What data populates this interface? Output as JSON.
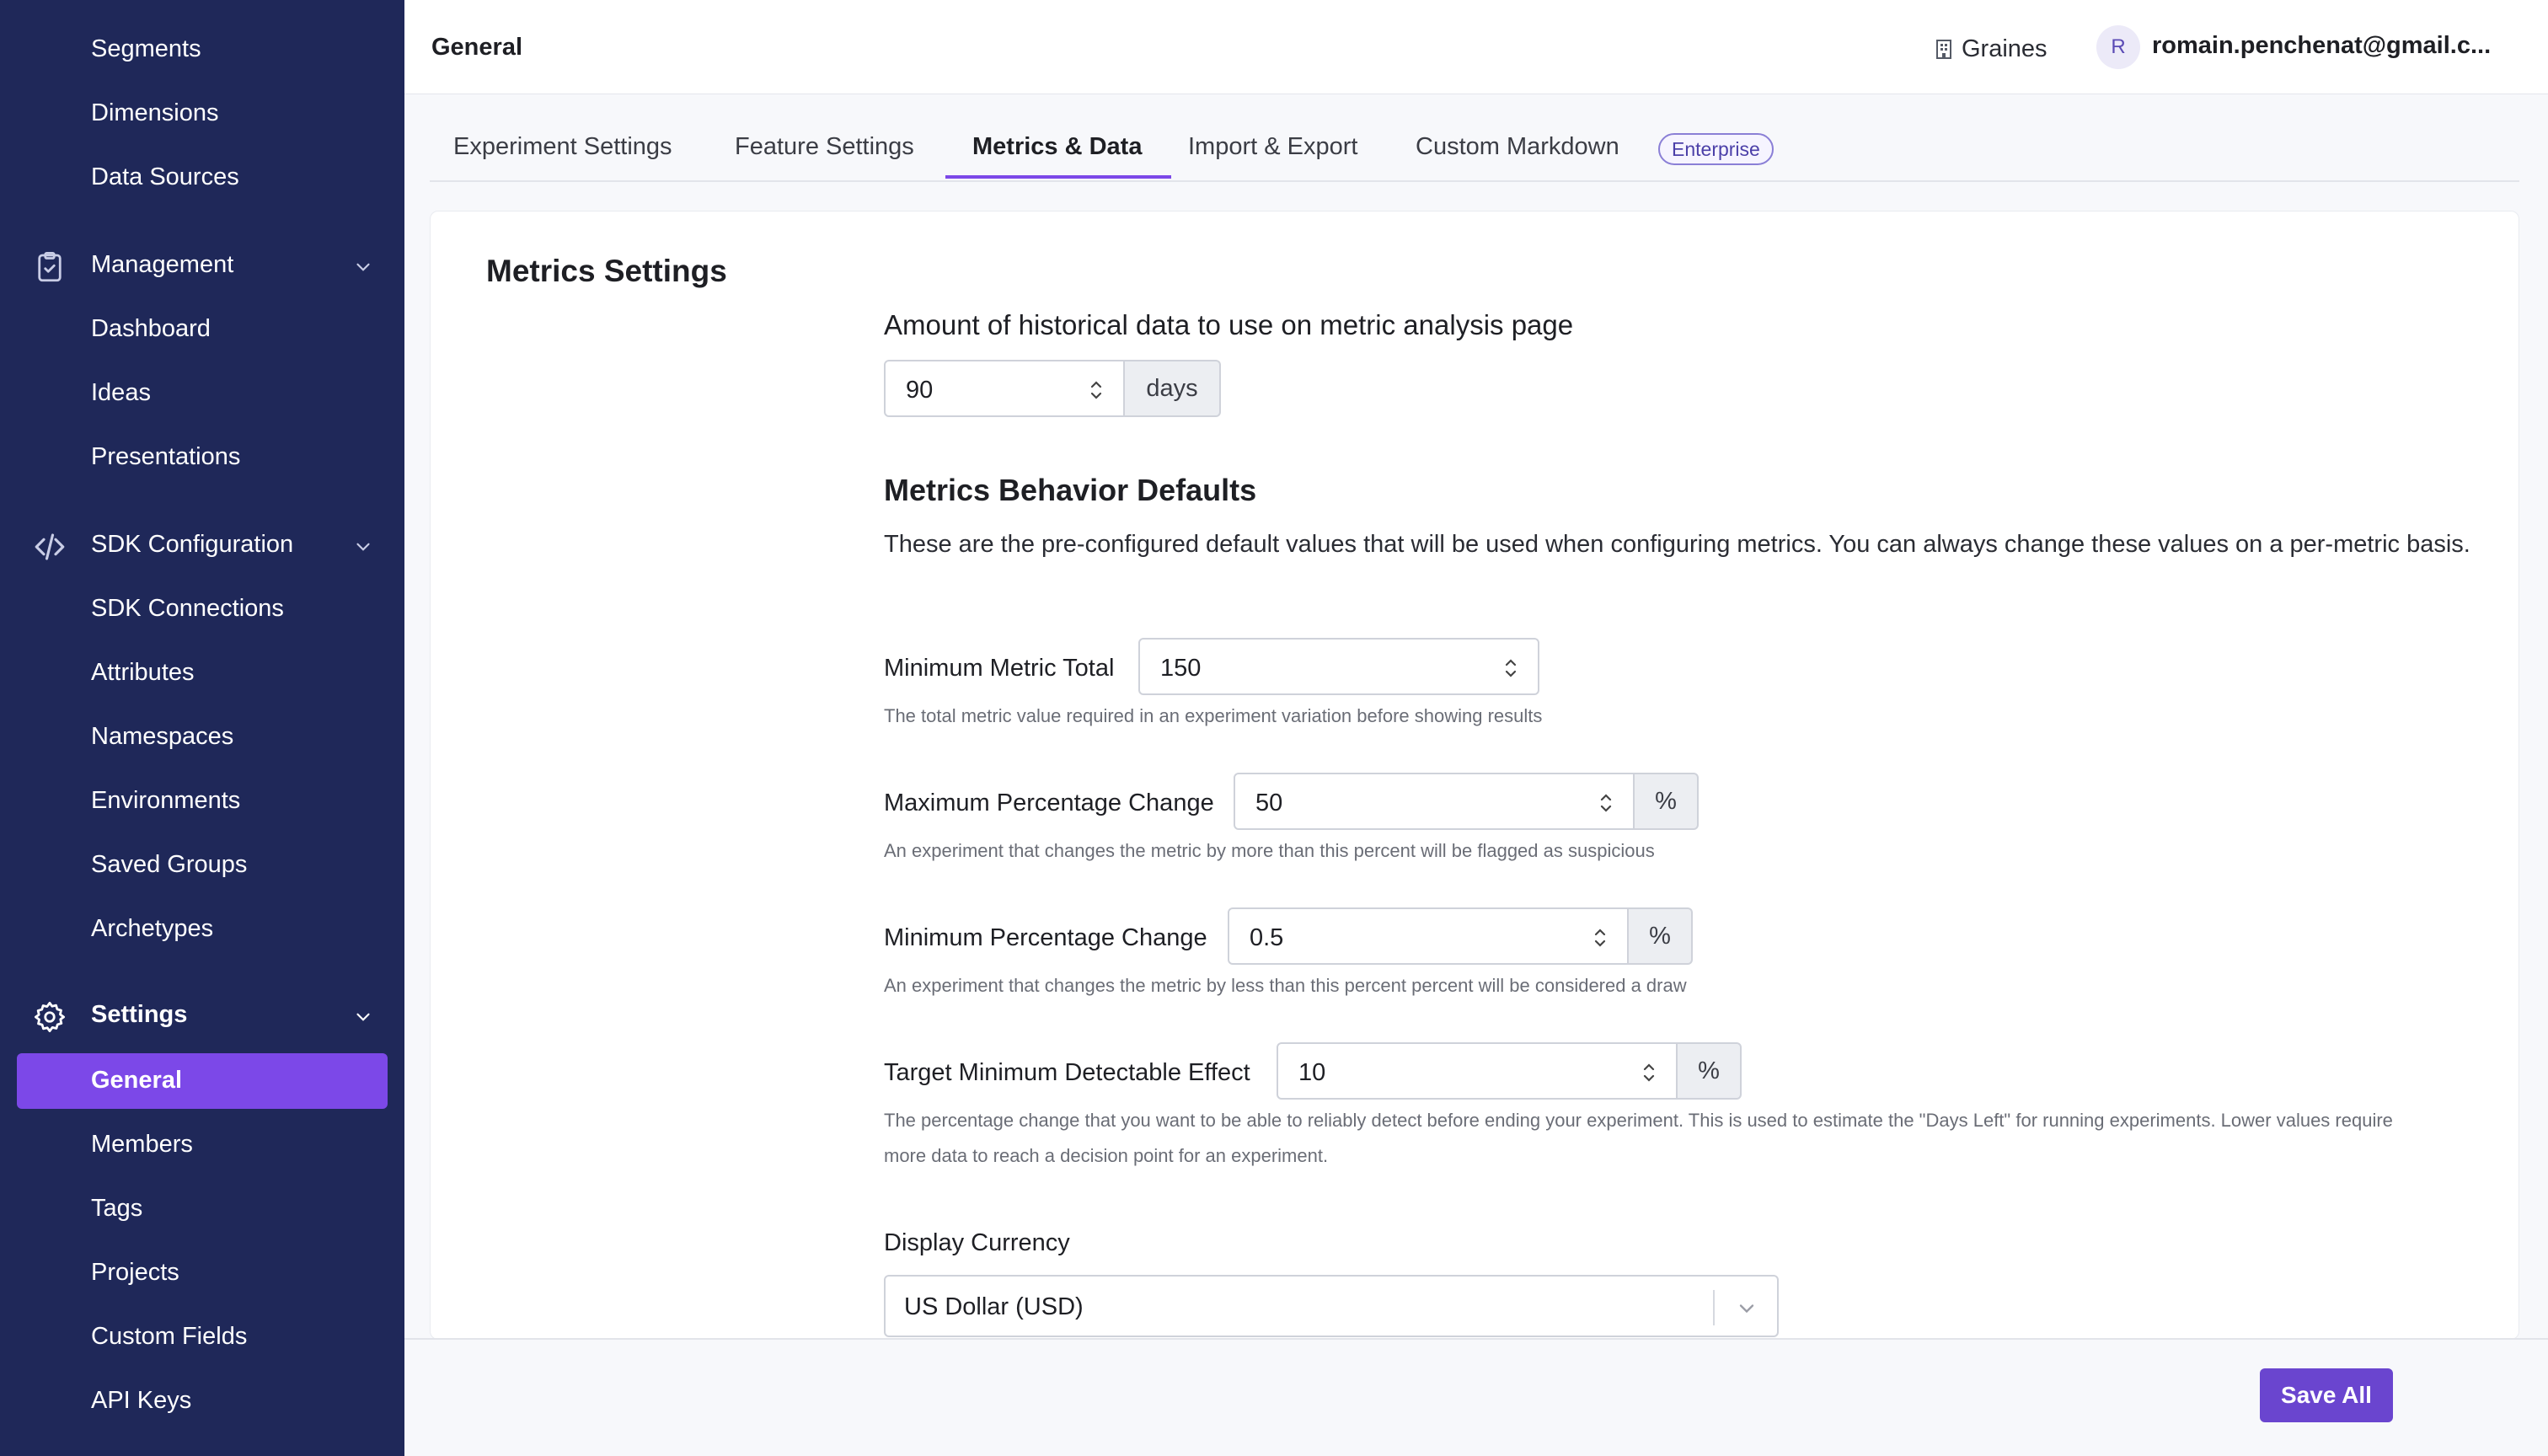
{
  "sidebar": {
    "top_items": [
      "Segments",
      "Dimensions",
      "Data Sources"
    ],
    "management": {
      "label": "Management",
      "icon": "clipboard-icon",
      "items": [
        "Dashboard",
        "Ideas",
        "Presentations"
      ]
    },
    "sdk": {
      "label": "SDK Configuration",
      "icon": "code-icon",
      "items": [
        "SDK Connections",
        "Attributes",
        "Namespaces",
        "Environments",
        "Saved Groups",
        "Archetypes"
      ]
    },
    "settings": {
      "label": "Settings",
      "icon": "gear-icon",
      "active_item": "General",
      "items": [
        "Members",
        "Tags",
        "Projects",
        "Custom Fields",
        "API Keys"
      ]
    }
  },
  "header": {
    "title": "General",
    "org_name": "Graines",
    "avatar_initial": "R",
    "user_email": "romain.penchenat@gmail.c..."
  },
  "tabs": {
    "items": [
      "Experiment Settings",
      "Feature Settings",
      "Metrics & Data",
      "Import & Export",
      "Custom Markdown"
    ],
    "active": "Metrics & Data",
    "badge": "Enterprise"
  },
  "metrics": {
    "section_title": "Metrics Settings",
    "history_label": "Amount of historical data to use on metric analysis page",
    "history_value": "90",
    "history_unit": "days",
    "behavior_title": "Metrics Behavior Defaults",
    "behavior_desc": "These are the pre-configured default values that will be used when configuring metrics. You can always change these values on a per-metric basis.",
    "min_total": {
      "label": "Minimum Metric Total",
      "value": "150",
      "help": "The total metric value required in an experiment variation before showing results"
    },
    "max_change": {
      "label": "Maximum Percentage Change",
      "value": "50",
      "unit": "%",
      "help": "An experiment that changes the metric by more than this percent will be flagged as suspicious"
    },
    "min_change": {
      "label": "Minimum Percentage Change",
      "value": "0.5",
      "unit": "%",
      "help": "An experiment that changes the metric by less than this percent percent will be considered a draw"
    },
    "mde": {
      "label": "Target Minimum Detectable Effect",
      "value": "10",
      "unit": "%",
      "help": "The percentage change that you want to be able to reliably detect before ending your experiment. This is used to estimate the \"Days Left\" for running experiments. Lower values require more data to reach a decision point for an experiment."
    },
    "currency": {
      "label": "Display Currency",
      "value": "US Dollar (USD)"
    }
  },
  "footer": {
    "save_label": "Save All"
  },
  "colors": {
    "sidebar_bg": "#1f2859",
    "accent": "#7c48e8",
    "save_button": "#6a45cf"
  }
}
